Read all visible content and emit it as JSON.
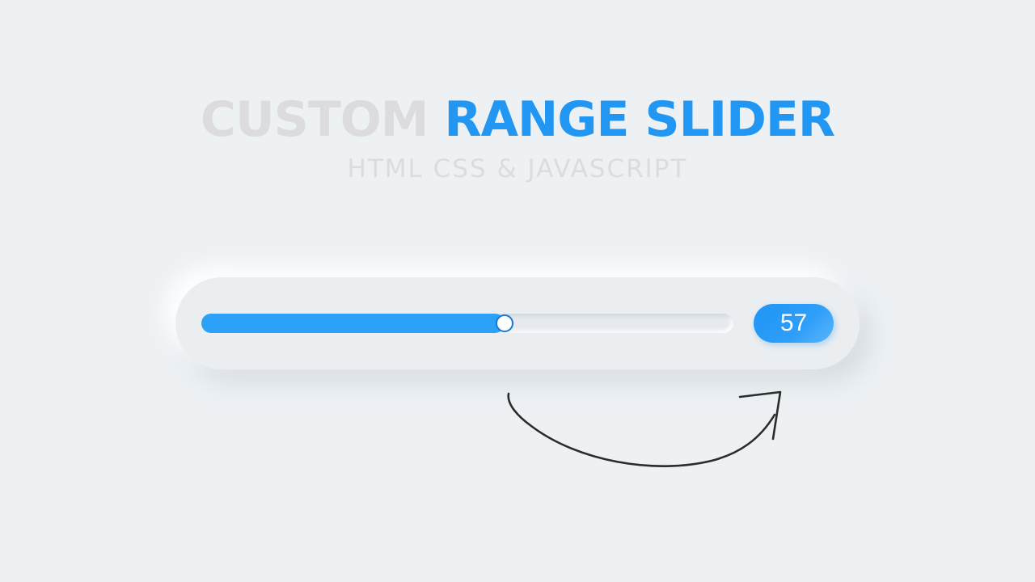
{
  "header": {
    "title_muted": "CUSTOM",
    "title_accent": "RANGE SLIDER",
    "subtitle": "HTML CSS & JAVASCRIPT"
  },
  "slider": {
    "value": 57,
    "value_label": "57",
    "min": 0,
    "max": 100
  },
  "colors": {
    "background": "#edf1f4",
    "accent": "#2196f3",
    "muted_text": "#dcdcde"
  },
  "icons": {
    "arrow": "curved-arrow-icon"
  }
}
